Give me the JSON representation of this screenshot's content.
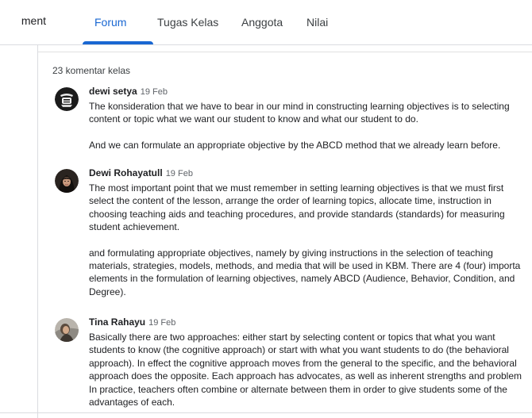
{
  "header": {
    "class_name_partial": "ment",
    "tabs": [
      {
        "label": "Forum",
        "active": true
      },
      {
        "label": "Tugas Kelas",
        "active": false
      },
      {
        "label": "Anggota",
        "active": false
      },
      {
        "label": "Nilai",
        "active": false
      }
    ]
  },
  "colors": {
    "accent": "#1967d2"
  },
  "comments": {
    "count_label": "23 komentar kelas",
    "items": [
      {
        "author": "dewi setya",
        "date": "19 Feb",
        "avatar_icon": "badge-avatar-icon",
        "lines": [
          [
            "The konsideration that we have to bear in our mind in constructing learning objectives is to selecting",
            "content or topic what we want our student to know and what our student to do."
          ],
          [
            "And we can formulate an appropriate objective by the ABCD method that we already learn before."
          ]
        ]
      },
      {
        "author": "Dewi Rohayatull",
        "date": "19 Feb",
        "avatar_icon": "hijab-avatar-icon",
        "lines": [
          [
            "The most important point that we must remember in setting learning objectives is that we must first",
            "select the content of the lesson, arrange the order of learning topics, allocate time, instruction in",
            "choosing teaching aids and teaching procedures, and provide standards (standards) for measuring",
            "student achievement."
          ],
          [
            "and formulating appropriate objectives, namely by giving instructions in the selection of teaching",
            "materials, strategies, models, methods, and media that will be used in KBM. There are 4 (four) importa",
            "elements in the formulation of learning objectives, namely ABCD (Audience, Behavior, Condition, and",
            "Degree)."
          ]
        ]
      },
      {
        "author": "Tina Rahayu",
        "date": "19 Feb",
        "avatar_icon": "photo-avatar-icon",
        "lines": [
          [
            "Basically there are two approaches: either start by selecting content or topics that what you want",
            "students to know (the cognitive approach) or start with what you want students to do (the behavioral",
            "approach). In effect the cognitive approach moves from the general to the specific, and the behavioral",
            "approach does the opposite. Each approach has advocates, as well as inherent strengths and problem",
            "In practice, teachers often combine or alternate between them in order to give students some of the",
            "advantages of each."
          ]
        ]
      }
    ]
  }
}
